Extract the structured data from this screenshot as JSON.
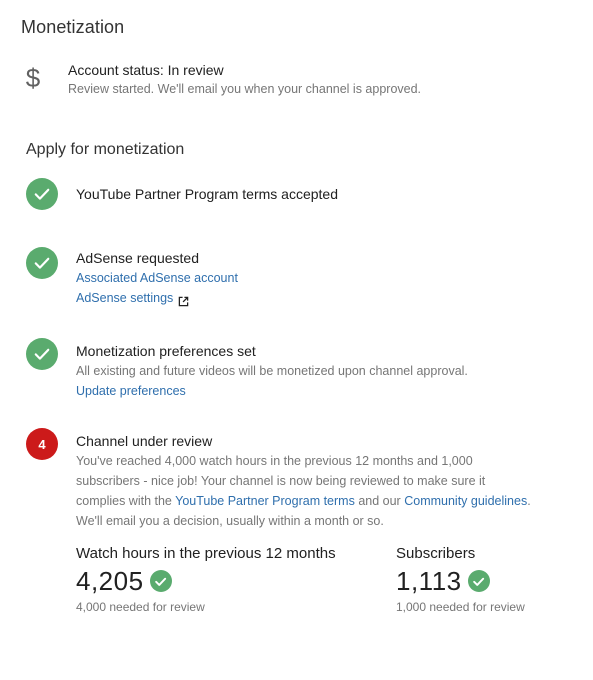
{
  "header": {
    "title": "Monetization"
  },
  "account_status": {
    "icon": "dollar-icon",
    "title": "Account status: In review",
    "subtitle": "Review started. We'll email you when your channel is approved."
  },
  "apply": {
    "title": "Apply for monetization",
    "steps": [
      {
        "status": "complete",
        "title": "YouTube Partner Program terms accepted"
      },
      {
        "status": "complete",
        "title": "AdSense requested",
        "links": [
          "Associated AdSense account",
          "AdSense settings"
        ]
      },
      {
        "status": "complete",
        "title": "Monetization preferences set",
        "text": "All existing and future videos will be monetized upon channel approval.",
        "links": [
          "Update preferences"
        ]
      },
      {
        "status": "in-progress",
        "number": "4",
        "title": "Channel under review",
        "text_part1": "You've reached 4,000 watch hours in the previous 12 months and 1,000",
        "text_part2": "subscribers - nice job! Your channel is now being reviewed to make sure it",
        "text_part3": "complies with the",
        "link_terms": "YouTube Partner Program terms",
        "text_part4": "and our",
        "link_guidelines": "Community guidelines",
        "text_part5": ".",
        "text_part6": "We'll email you a decision, usually within a month or so."
      }
    ]
  },
  "metrics": {
    "watch_hours": {
      "label": "Watch hours in the previous 12 months",
      "value": "4,205",
      "note": "4,000 needed for review"
    },
    "subscribers": {
      "label": "Subscribers",
      "value": "1,113",
      "note": "1,000 needed for review"
    }
  },
  "colors": {
    "success": "#5aab6e",
    "alert": "#cc1a1a",
    "link": "#2f6fad"
  }
}
